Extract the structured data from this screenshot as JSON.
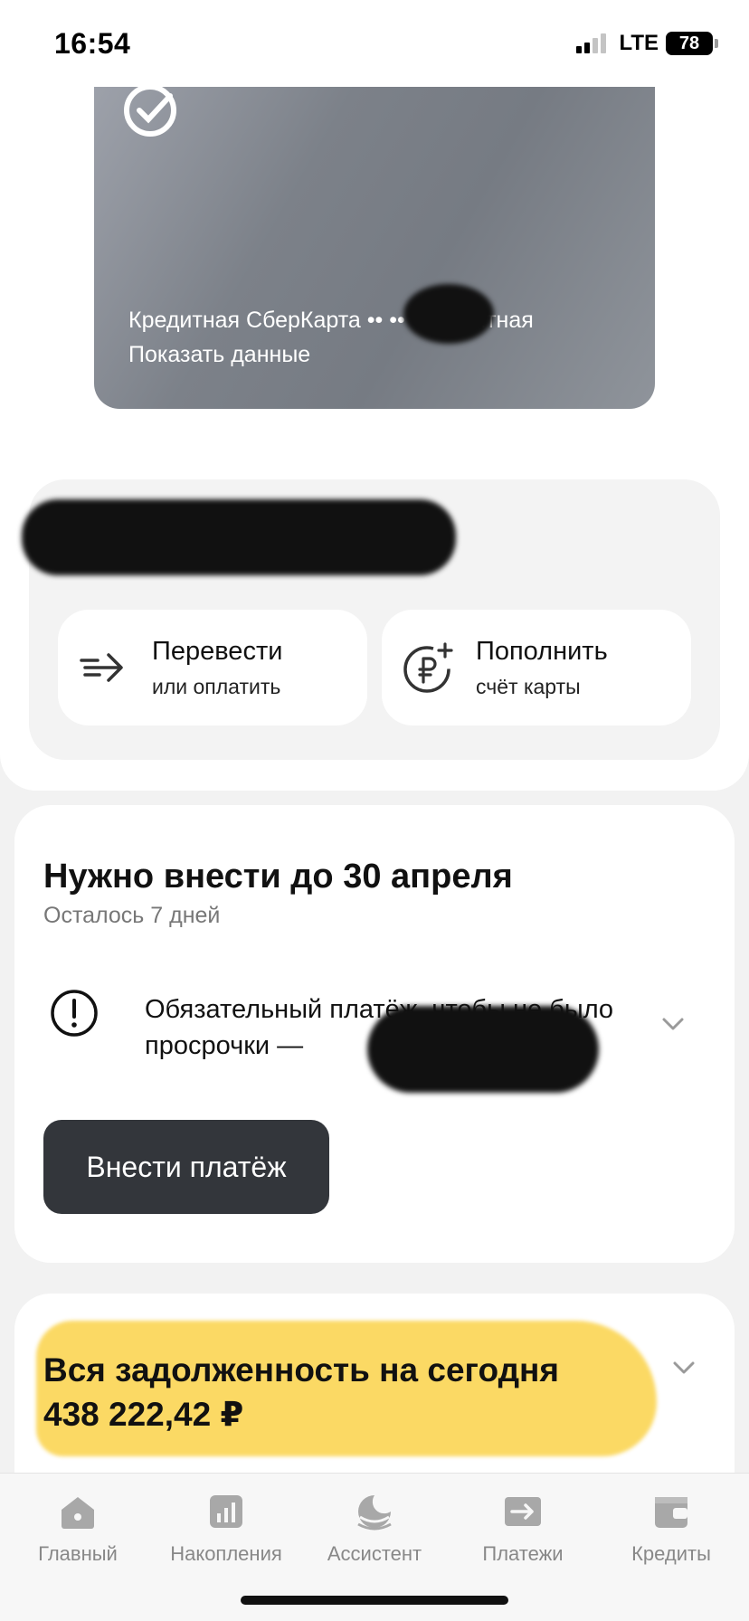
{
  "status_bar": {
    "time": "16:54",
    "network": "LTE",
    "battery": "78"
  },
  "card": {
    "title": "Кредитная СберКарта •• •• • кредитная",
    "show_data": "Показать данные"
  },
  "actions": {
    "transfer": {
      "title": "Перевести",
      "subtitle": "или оплатить"
    },
    "topup": {
      "title": "Пополнить",
      "subtitle": "счёт карты"
    }
  },
  "payment": {
    "title": "Нужно внести до 30 апреля",
    "subtitle": "Осталось 7 дней",
    "notice": "Обязательный платёж, чтобы не было просрочки —",
    "button": "Внести платёж"
  },
  "debt": {
    "label": "Вся задолженность на сегодня",
    "amount": "438 222,42 ₽"
  },
  "tabs": [
    {
      "label": "Главный",
      "icon": "home-icon"
    },
    {
      "label": "Накопления",
      "icon": "savings-chart-icon"
    },
    {
      "label": "Ассистент",
      "icon": "assistant-icon"
    },
    {
      "label": "Платежи",
      "icon": "payments-arrow-icon"
    },
    {
      "label": "Кредиты",
      "icon": "wallet-icon"
    }
  ],
  "colors": {
    "accent_highlight": "#fbd75c",
    "button_dark": "#33363b",
    "card_gray": "#7c8189"
  }
}
